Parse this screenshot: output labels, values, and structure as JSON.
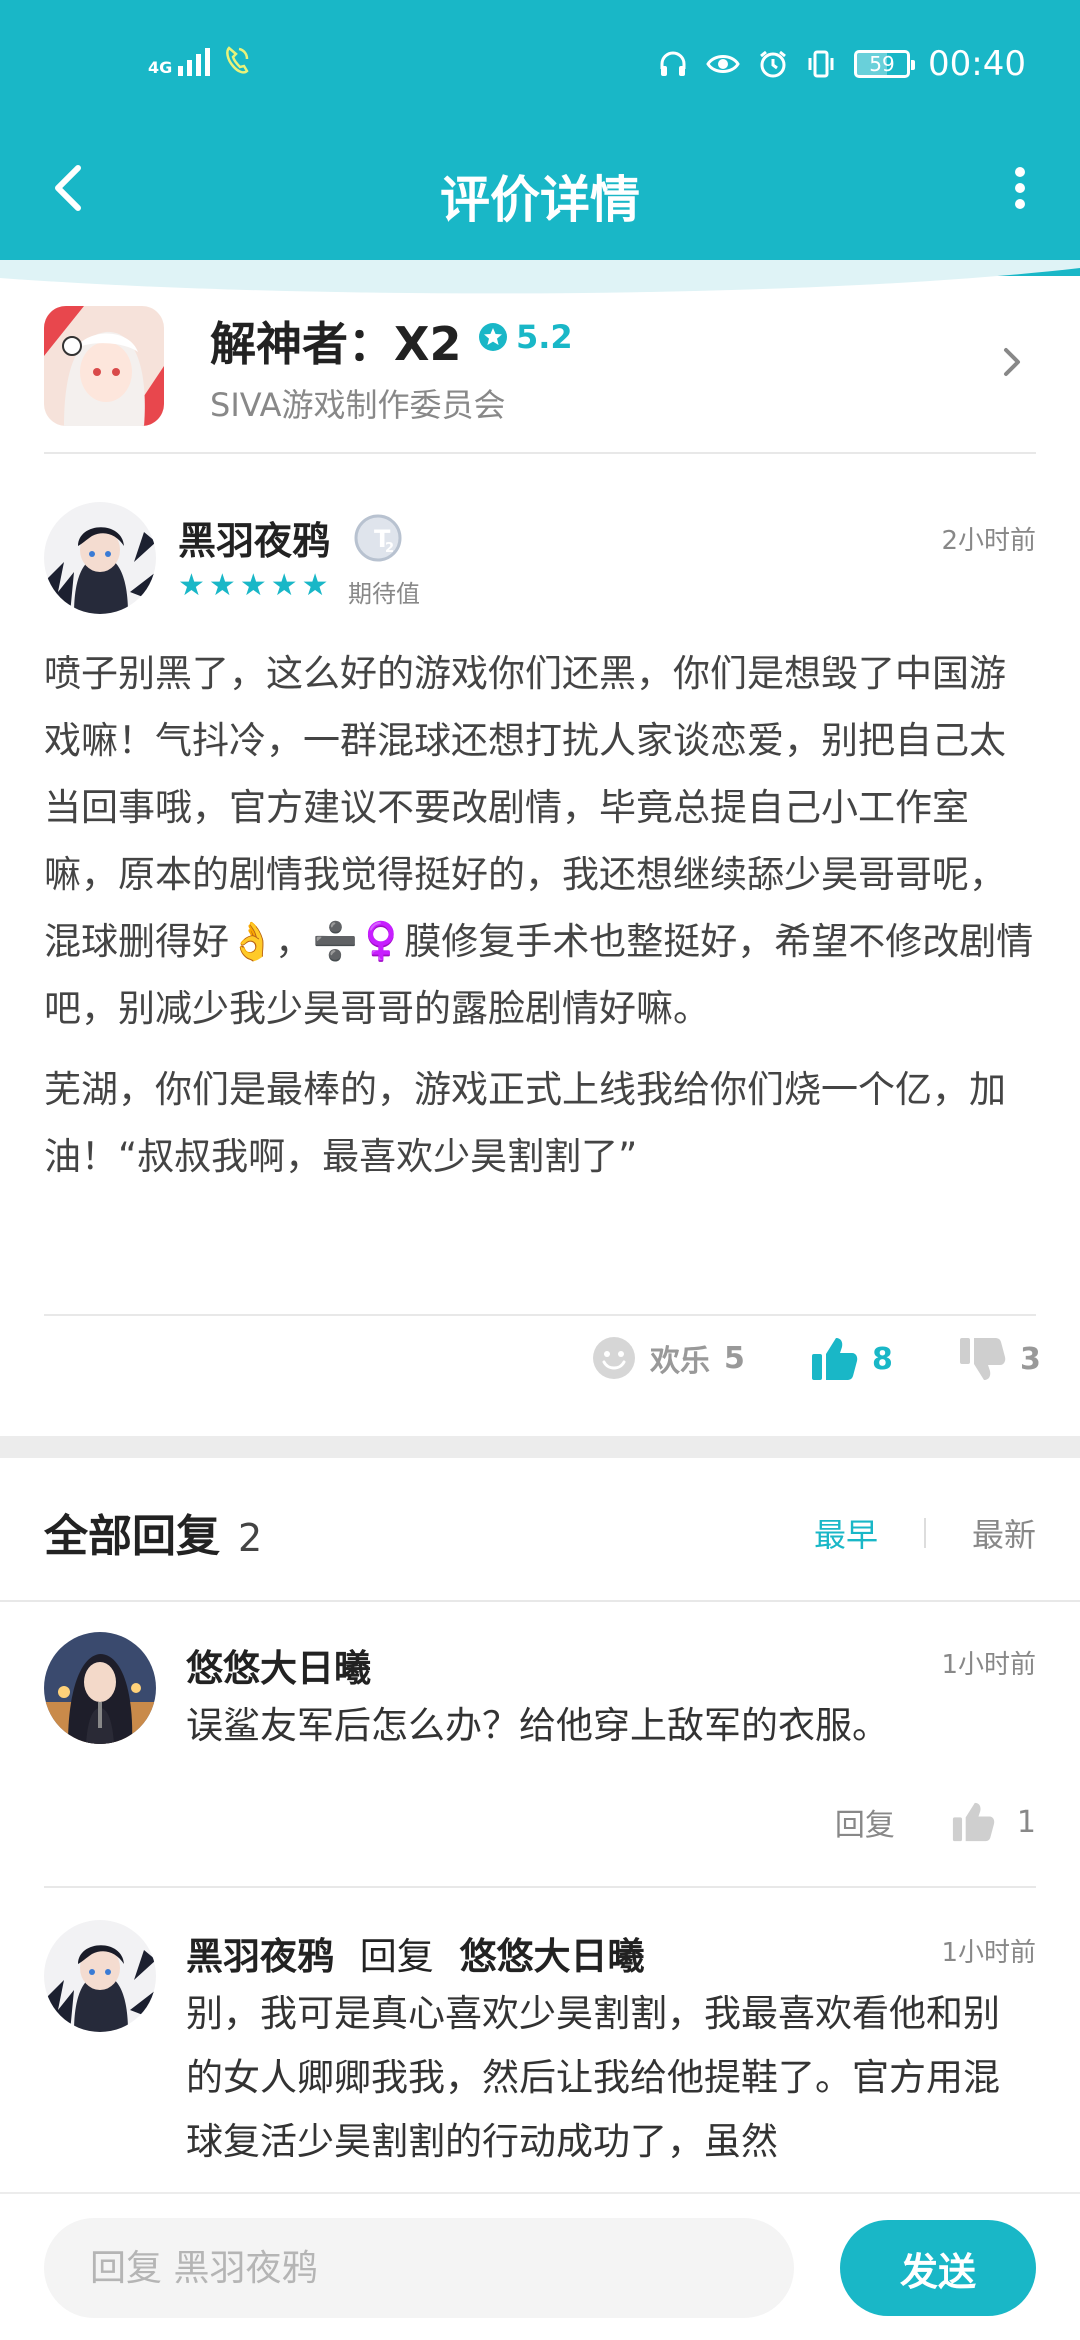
{
  "status_bar": {
    "network": "4G",
    "battery": "59",
    "battery_fraction": 0.59,
    "time": "00:40",
    "icons": [
      "signal-icon",
      "phone-call-icon",
      "headphones-icon",
      "eye-icon",
      "alarm-icon",
      "vibrate-icon",
      "battery-icon"
    ]
  },
  "header": {
    "title": "评价详情"
  },
  "app": {
    "name": "解神者：X2",
    "rating": "5.2",
    "developer": "SIVA游戏制作委员会"
  },
  "review": {
    "author": "黑羽夜鸦",
    "badge": "T2",
    "stars": 5,
    "star_label": "期待值",
    "time": "2小时前",
    "paragraphs": [
      "喷子别黑了，这么好的游戏你们还黑，你们是想毁了中国游戏嘛！气抖冷，一群混球还想打扰人家谈恋爱，别把自己太当回事哦，官方建议不要改剧情，毕竟总提自己小工作室嘛，原本的剧情我觉得挺好的，我还想继续舔少昊哥哥呢，混球删得好👌，➗♀️膜修复手术也整挺好，希望不修改剧情吧，别减少我少昊哥哥的露脸剧情好嘛。",
      "芜湖，你们是最棒的，游戏正式上线我给你们烧一个亿，加油！“叔叔我啊，最喜欢少昊割割了”"
    ],
    "actions": {
      "fun_label": "欢乐",
      "fun_count": "5",
      "like_count": "8",
      "dislike_count": "3"
    }
  },
  "replies": {
    "title": "全部回复",
    "count": "2",
    "sort_earliest": "最早",
    "sort_latest": "最新",
    "items": [
      {
        "author": "悠悠大日曦",
        "time": "1小时前",
        "text": "误鲨友军后怎么办？给他穿上敌军的衣服。",
        "reply_label": "回复",
        "like_count": "1"
      },
      {
        "author": "黑羽夜鸦",
        "reply_word": "回复",
        "reply_to": "悠悠大日曦",
        "time": "1小时前",
        "text": "别，我可是真心喜欢少昊割割，我最喜欢看他和别的女人卿卿我我，然后让我给他提鞋了。官方用混球复活少昊割割的行动成功了，虽然"
      }
    ]
  },
  "composer": {
    "placeholder": "回复 黑羽夜鸦",
    "send_label": "发送"
  },
  "colors": {
    "accent": "#19b7c7",
    "muted": "#888888"
  }
}
